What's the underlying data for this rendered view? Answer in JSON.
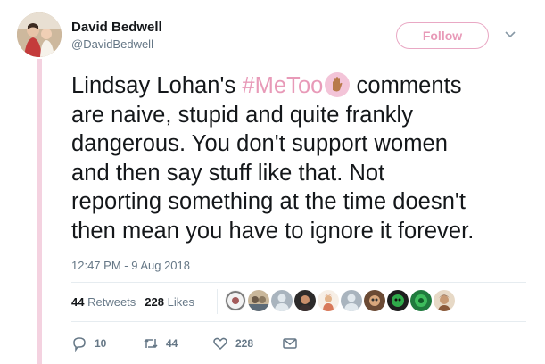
{
  "user": {
    "display_name": "David Bedwell",
    "handle": "@DavidBedwell",
    "follow_label": "Follow"
  },
  "tweet": {
    "line1_before": "Lindsay Lohan's ",
    "hashtag": "#MeToo",
    "line1_after": " comments",
    "line2": "are naive, stupid and quite frankly",
    "line3": "dangerous. You don't support women",
    "line4": "and then say stuff like that. Not",
    "line5": "reporting something at the time doesn't",
    "line6": "then mean you have to ignore it forever.",
    "timestamp": "12:47 PM - 9 Aug 2018"
  },
  "stats": {
    "retweets_count": "44",
    "retweets_label": "Retweets",
    "likes_count": "228",
    "likes_label": "Likes"
  },
  "actions": {
    "replies": "10",
    "retweets": "44",
    "likes": "228"
  },
  "colors": {
    "accent_pink": "#e89ab8",
    "text_primary": "#14171a",
    "text_secondary": "#657786"
  },
  "icons": [
    "chevron-down-icon",
    "raised-hand-icon",
    "reply-icon",
    "retweet-icon",
    "heart-icon",
    "message-icon"
  ]
}
